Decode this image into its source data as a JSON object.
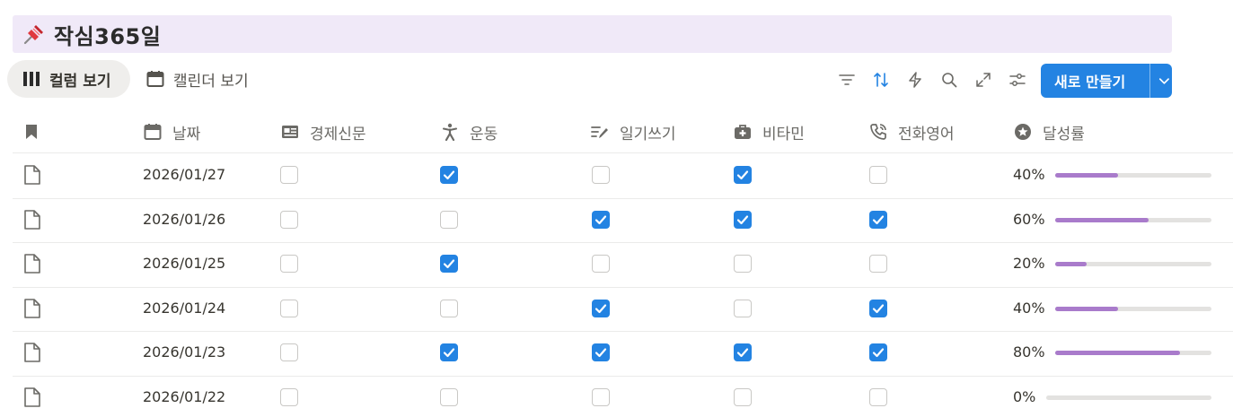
{
  "page": {
    "title": "작심365일",
    "title_bg": "#f0e9f8",
    "icon": "pushpin-icon"
  },
  "views": [
    {
      "label": "컬럼 보기",
      "icon": "columns-icon",
      "active": true
    },
    {
      "label": "캘린더 보기",
      "icon": "calendar-icon",
      "active": false
    }
  ],
  "toolbar": {
    "icons": [
      "filter-icon",
      "sort-icon",
      "automation-icon",
      "search-icon",
      "expand-icon",
      "settings-icon"
    ],
    "new_label": "새로 만들기",
    "accent": "#2383e2"
  },
  "columns": [
    {
      "label": "",
      "icon": "bookmark-icon"
    },
    {
      "label": "날짜",
      "icon": "calendar-icon"
    },
    {
      "label": "경제신문",
      "icon": "newspaper-icon"
    },
    {
      "label": "운동",
      "icon": "person-icon"
    },
    {
      "label": "일기쓰기",
      "icon": "pen-icon"
    },
    {
      "label": "비타민",
      "icon": "medkit-icon"
    },
    {
      "label": "전화영어",
      "icon": "phone-icon"
    },
    {
      "label": "달성률",
      "icon": "star-icon"
    }
  ],
  "rows": [
    {
      "date": "2026/01/27",
      "checks": [
        false,
        true,
        false,
        true,
        false
      ],
      "rate": "40%",
      "progress": 0.4
    },
    {
      "date": "2026/01/26",
      "checks": [
        false,
        false,
        true,
        true,
        true
      ],
      "rate": "60%",
      "progress": 0.6
    },
    {
      "date": "2026/01/25",
      "checks": [
        false,
        true,
        false,
        false,
        false
      ],
      "rate": "20%",
      "progress": 0.2
    },
    {
      "date": "2026/01/24",
      "checks": [
        false,
        false,
        true,
        false,
        true
      ],
      "rate": "40%",
      "progress": 0.4
    },
    {
      "date": "2026/01/23",
      "checks": [
        false,
        true,
        true,
        true,
        true
      ],
      "rate": "80%",
      "progress": 0.8
    },
    {
      "date": "2026/01/22",
      "checks": [
        false,
        false,
        false,
        false,
        false
      ],
      "rate": "0%",
      "progress": 0.0
    }
  ],
  "colors": {
    "progress_fill": "#a97bcb",
    "progress_track": "#e3e2e0",
    "checkbox_on": "#2383e2"
  }
}
